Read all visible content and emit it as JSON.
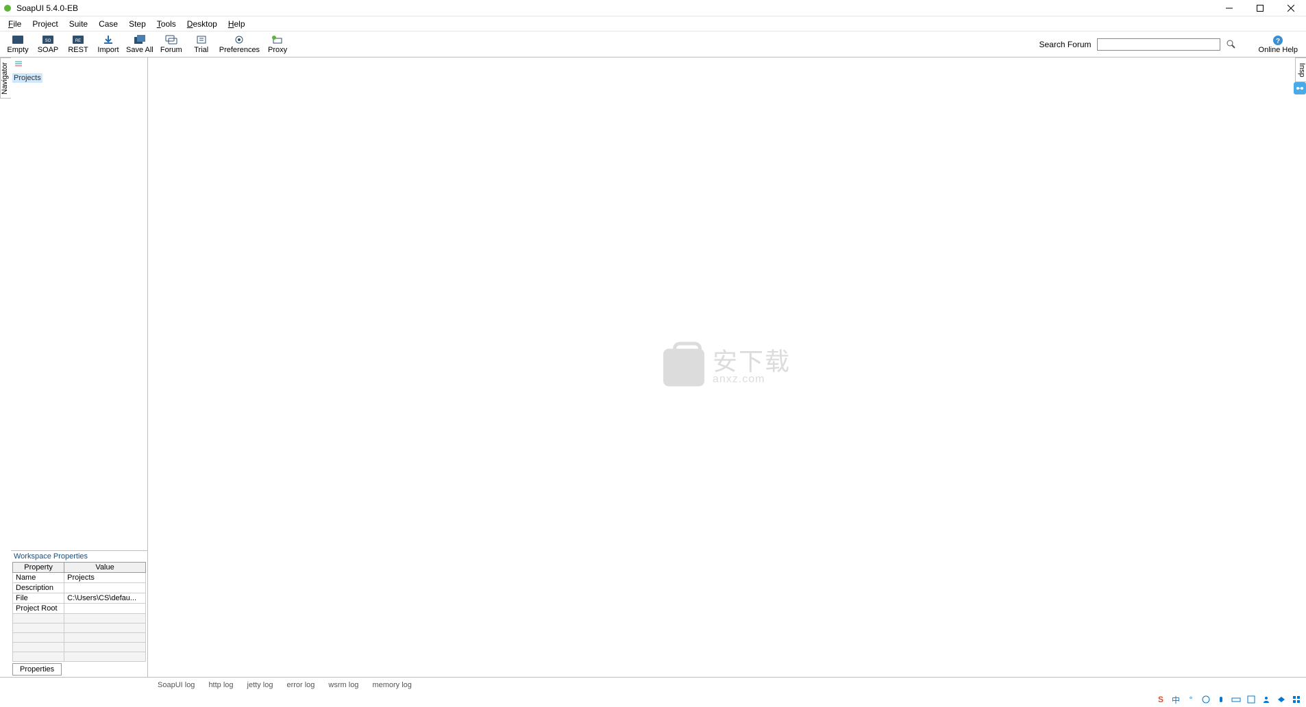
{
  "window": {
    "title": "SoapUI 5.4.0-EB"
  },
  "menubar": {
    "file": "File",
    "project": "Project",
    "suite": "Suite",
    "case": "Case",
    "step": "Step",
    "tools": "Tools",
    "desktop": "Desktop",
    "help": "Help"
  },
  "toolbar": {
    "empty": "Empty",
    "soap": "SOAP",
    "rest": "REST",
    "import": "Import",
    "save_all": "Save All",
    "forum": "Forum",
    "trial": "Trial",
    "preferences": "Preferences",
    "proxy": "Proxy",
    "search_label": "Search Forum",
    "search_placeholder": "",
    "online_help": "Online Help"
  },
  "sidebar": {
    "navigator_tab": "Navigator",
    "tree_root": "Projects",
    "properties_title": "Workspace Properties",
    "header_property": "Property",
    "header_value": "Value",
    "rows": [
      {
        "property": "Name",
        "value": "Projects"
      },
      {
        "property": "Description",
        "value": ""
      },
      {
        "property": "File",
        "value": "C:\\Users\\CS\\defau..."
      },
      {
        "property": "Project Root",
        "value": ""
      }
    ],
    "properties_tab": "Properties"
  },
  "inspector_tab": "Insp",
  "watermark": {
    "cn": "安下载",
    "en": "anxz.com"
  },
  "log_tabs": {
    "soapui": "SoapUI log",
    "http": "http log",
    "jetty": "jetty log",
    "error": "error log",
    "wsrm": "wsrm log",
    "memory": "memory log"
  }
}
